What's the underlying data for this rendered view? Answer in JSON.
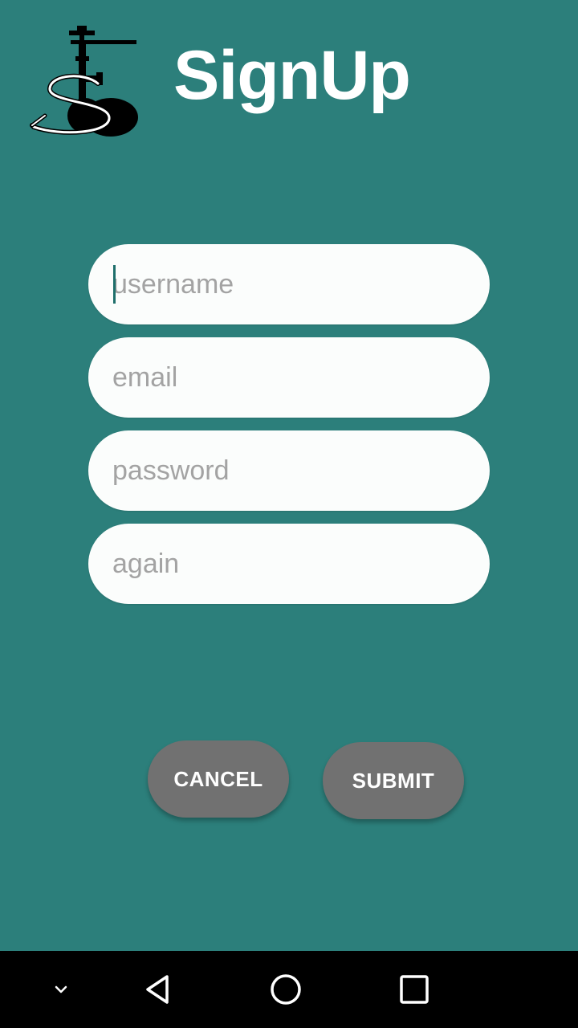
{
  "header": {
    "title": "SignUp",
    "logo_icon": "hookah-logo-icon"
  },
  "form": {
    "username_placeholder": "username",
    "email_placeholder": "email",
    "password_placeholder": "password",
    "again_placeholder": "again",
    "username_value": "",
    "email_value": "",
    "password_value": "",
    "again_value": ""
  },
  "actions": {
    "cancel_label": "CANCEL",
    "submit_label": "SUBMIT"
  },
  "system_nav": {
    "items": [
      "chevron-down-icon",
      "back-triangle-icon",
      "home-circle-icon",
      "recents-square-icon"
    ]
  },
  "colors": {
    "background": "#2c7f7b",
    "field": "#fbfdfc",
    "button": "#717171",
    "navbar": "#000000",
    "title": "#ffffff"
  }
}
